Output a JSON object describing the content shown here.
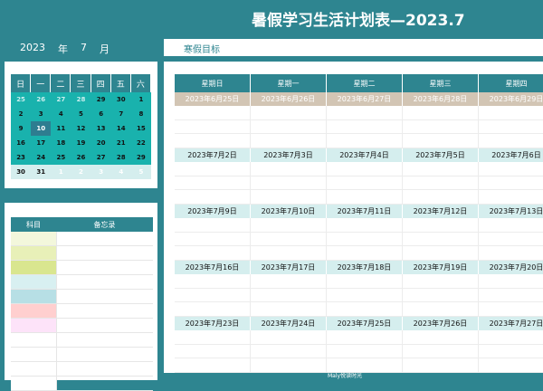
{
  "title": "暑假学习生活计划表—2023.7",
  "year": "2023",
  "year_label": "年",
  "month": "7",
  "month_label": "月",
  "goal_label": "寒假目标",
  "mini_calendar": {
    "headers": [
      "日",
      "一",
      "二",
      "三",
      "四",
      "五",
      "六"
    ],
    "weeks": [
      [
        {
          "d": "25",
          "o": true
        },
        {
          "d": "26",
          "o": true
        },
        {
          "d": "27",
          "o": true
        },
        {
          "d": "28",
          "o": true
        },
        {
          "d": "29",
          "o": false
        },
        {
          "d": "30",
          "o": false
        },
        {
          "d": "1",
          "o": false
        }
      ],
      [
        {
          "d": "2",
          "o": false
        },
        {
          "d": "3",
          "o": false
        },
        {
          "d": "4",
          "o": false
        },
        {
          "d": "5",
          "o": false
        },
        {
          "d": "6",
          "o": false
        },
        {
          "d": "7",
          "o": false
        },
        {
          "d": "8",
          "o": false
        }
      ],
      [
        {
          "d": "9",
          "o": false
        },
        {
          "d": "10",
          "o": false,
          "hl": true
        },
        {
          "d": "11",
          "o": false
        },
        {
          "d": "12",
          "o": false
        },
        {
          "d": "13",
          "o": false
        },
        {
          "d": "14",
          "o": false
        },
        {
          "d": "15",
          "o": false
        }
      ],
      [
        {
          "d": "16",
          "o": false
        },
        {
          "d": "17",
          "o": false
        },
        {
          "d": "18",
          "o": false
        },
        {
          "d": "19",
          "o": false
        },
        {
          "d": "20",
          "o": false
        },
        {
          "d": "21",
          "o": false
        },
        {
          "d": "22",
          "o": false
        }
      ],
      [
        {
          "d": "23",
          "o": false
        },
        {
          "d": "24",
          "o": false
        },
        {
          "d": "25",
          "o": false
        },
        {
          "d": "26",
          "o": false
        },
        {
          "d": "27",
          "o": false
        },
        {
          "d": "28",
          "o": false
        },
        {
          "d": "29",
          "o": false
        }
      ],
      [
        {
          "d": "30",
          "o": false,
          "light": true
        },
        {
          "d": "31",
          "o": false,
          "light": true
        },
        {
          "d": "1",
          "o": true,
          "light": true
        },
        {
          "d": "2",
          "o": true,
          "light": true
        },
        {
          "d": "3",
          "o": true,
          "light": true
        },
        {
          "d": "4",
          "o": true,
          "light": true
        },
        {
          "d": "5",
          "o": true,
          "light": true
        }
      ]
    ]
  },
  "notes": {
    "col_subject": "科目",
    "col_memo": "备忘录",
    "row_colors": [
      "#f3f7dc",
      "#e8f0b8",
      "#d9e68f",
      "#d8f0f1",
      "#b7dfe5",
      "#ffcfcf",
      "#fde3f9",
      "#ffffff",
      "#ffffff",
      "#ffffff",
      "#ffffff"
    ]
  },
  "weekdays": [
    "星期日",
    "星期一",
    "星期二",
    "星期三",
    "星期四"
  ],
  "weeks": [
    {
      "prev": true,
      "dates": [
        "2023年6月25日",
        "2023年6月26日",
        "2023年6月27日",
        "2023年6月28日",
        "2023年6月29日"
      ]
    },
    {
      "prev": false,
      "dates": [
        "2023年7月2日",
        "2023年7月3日",
        "2023年7月4日",
        "2023年7月5日",
        "2023年7月6日"
      ]
    },
    {
      "prev": false,
      "dates": [
        "2023年7月9日",
        "2023年7月10日",
        "2023年7月11日",
        "2023年7月12日",
        "2023年7月13日"
      ]
    },
    {
      "prev": false,
      "dates": [
        "2023年7月16日",
        "2023年7月17日",
        "2023年7月18日",
        "2023年7月19日",
        "2023年7月20日"
      ]
    },
    {
      "prev": false,
      "dates": [
        "2023年7月23日",
        "2023年7月24日",
        "2023年7月25日",
        "2023年7月26日",
        "2023年7月27日"
      ]
    }
  ],
  "footer": "Maly悦读时光"
}
